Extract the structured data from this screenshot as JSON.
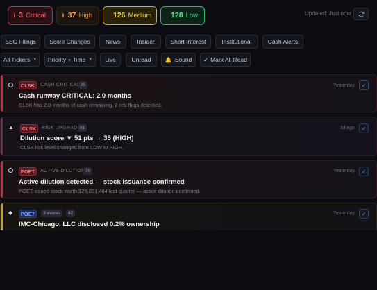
{
  "severity": {
    "critical": {
      "count": "3",
      "label": "Critical"
    },
    "high": {
      "count": "37",
      "label": "High"
    },
    "medium": {
      "count": "126",
      "label": "Medium"
    },
    "low": {
      "count": "128",
      "label": "Low"
    }
  },
  "updated_text": "Updated: Just now",
  "category_tabs": [
    "SEC Filings",
    "Score Changes",
    "News",
    "Insider",
    "Short Interest",
    "Institutional",
    "Cash Alerts"
  ],
  "filters": {
    "tickers": "All Tickers",
    "sort": "Priority + Time",
    "live": "Live",
    "unread": "Unread",
    "sound": "Sound",
    "mark_all_read": "Mark All Read"
  },
  "alerts": [
    {
      "ticker": "CLSK",
      "type": "CASH CRITICAL",
      "count": "95",
      "title": "Cash runway CRITICAL: 2.0 months",
      "description": "CLSK has 2.0 months of cash remaining. 2 red flags detected.",
      "time": "Yesterday"
    },
    {
      "ticker": "CLSK",
      "type": "RISK UPGRADE",
      "count": "81",
      "title": "Dilution score ▼ 51 pts → 35 (HIGH)",
      "description": "CLSK risk level changed from LOW to HIGH.",
      "time": "3d ago"
    },
    {
      "ticker": "POET",
      "type": "ACTIVE DILUTION",
      "count": "70",
      "title": "Active dilution detected — stock issuance confirmed",
      "description": "POET issued stock worth $25,851,464 last quarter — active dilution confirmed.",
      "time": "Yesterday"
    },
    {
      "ticker": "POET",
      "type": "3 events",
      "count": "42",
      "title": "IMC-Chicago, LLC disclosed 0.2% ownership",
      "description": "",
      "time": "Yesterday"
    }
  ],
  "colors": {
    "critical": "#ef4444",
    "high": "#e0702a",
    "medium": "#eab308",
    "low": "#22c55e",
    "background": "#0c0d12"
  },
  "icons": {
    "refresh": "refresh-icon",
    "sound": "bell-icon",
    "mark_all_read": "check-icon"
  }
}
